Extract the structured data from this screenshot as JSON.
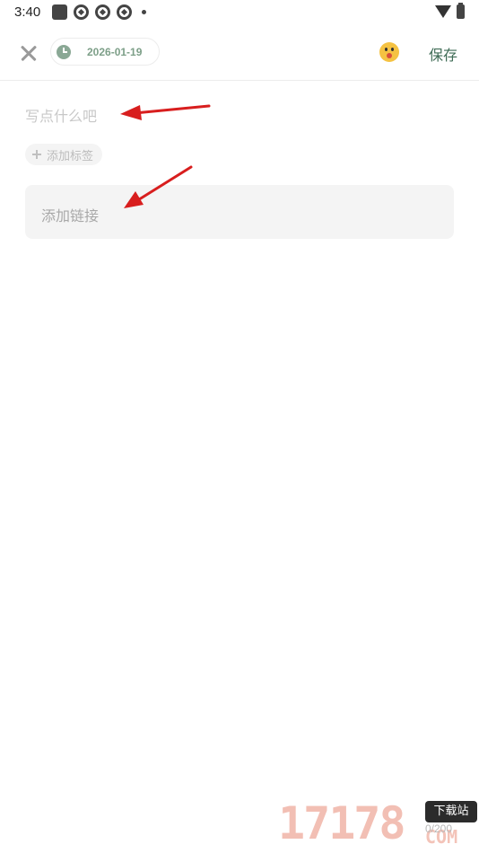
{
  "status_bar": {
    "time": "3:40"
  },
  "toolbar": {
    "date": "2026-01-19",
    "save_label": "保存"
  },
  "editor": {
    "content_placeholder": "写点什么吧",
    "add_tag_label": "添加标签",
    "add_link_label": "添加链接",
    "char_count": "0/200"
  },
  "watermark": {
    "number": "17178",
    "badge": "下载站",
    "suffix": "COM"
  },
  "colors": {
    "accent_green": "#3e6b55",
    "date_green": "#7d9f88",
    "annotation_arrow": "#d81e1e"
  },
  "icons": [
    "close-icon",
    "clock-icon",
    "emoji-mood-icon",
    "plus-icon",
    "wifi-icon",
    "battery-icon"
  ]
}
